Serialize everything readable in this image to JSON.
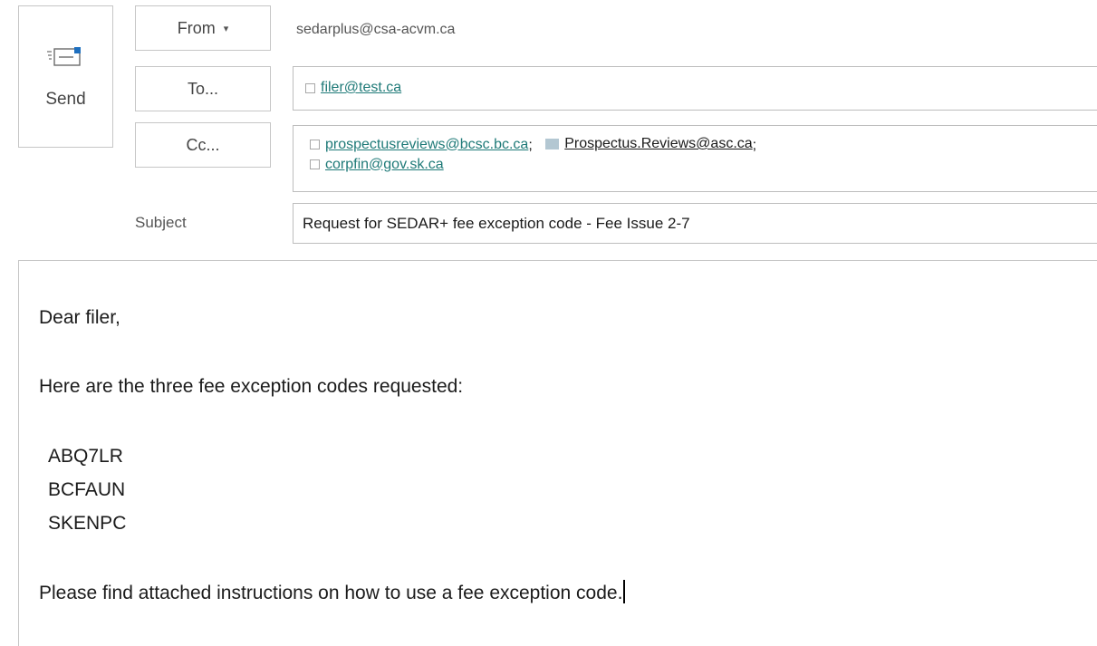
{
  "send": {
    "label": "Send",
    "icon": "send-envelope-icon"
  },
  "from": {
    "label": "From",
    "address": "sedarplus@csa-acvm.ca"
  },
  "to": {
    "label": "To...",
    "recipients": [
      {
        "address": "filer@test.ca"
      }
    ]
  },
  "cc": {
    "label": "Cc...",
    "recipients": [
      {
        "address": "prospectusreviews@bcsc.bc.ca",
        "separator": ";"
      },
      {
        "address": "Prospectus.Reviews@asc.ca",
        "separator": ";"
      },
      {
        "address": "corpfin@gov.sk.ca"
      }
    ]
  },
  "subject": {
    "label": "Subject",
    "value": "Request for SEDAR+ fee exception code - Fee Issue 2-7"
  },
  "body": {
    "greeting": "Dear filer,",
    "intro": "Here are the three fee exception codes requested:",
    "codes": [
      "ABQ7LR",
      "BCFAUN",
      "SKENPC"
    ],
    "closing": "Please find attached instructions on how to use a fee exception code."
  },
  "colors": {
    "link": "#1f7a78",
    "border": "#c6c6c6",
    "recipient_marker": "#b3c7d2"
  }
}
